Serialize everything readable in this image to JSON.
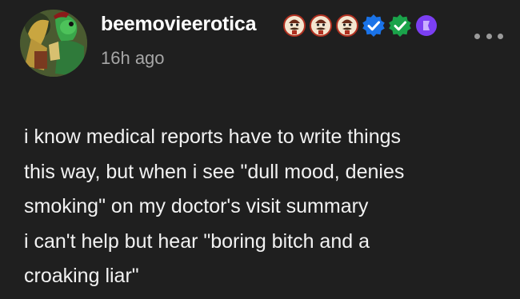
{
  "post": {
    "username": "beemovieerotica",
    "timestamp": "16h ago",
    "badges": [
      "vintage-man-badge-icon",
      "vintage-man-badge-icon",
      "vintage-man-badge-icon",
      "blue-verified-check-icon",
      "green-verified-check-icon",
      "purple-badge-icon"
    ],
    "lines": [
      "i know medical reports have to write things",
      "this way, but when i see \"dull mood, denies",
      "smoking\" on my doctor's visit summary",
      "i can't help but hear \"boring bitch and a",
      "croaking liar\""
    ]
  },
  "colors": {
    "background": "#1f1f1f",
    "text": "#f2f2f2",
    "muted": "#a6a6a6",
    "blue_badge": "#1a73e8",
    "green_badge": "#1aa34a",
    "purple_badge": "#7b3ff2"
  }
}
